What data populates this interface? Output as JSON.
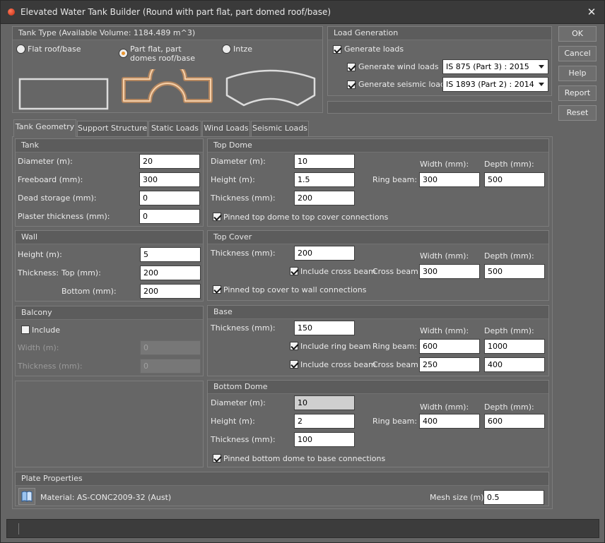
{
  "window": {
    "title": "Elevated Water Tank Builder (Round with part flat, part domed roof/base)",
    "close": "✕"
  },
  "tank_type": {
    "title": "Tank Type (Available Volume: 1184.489 m^3)",
    "options": [
      {
        "label": "Flat roof/base"
      },
      {
        "label1": "Part flat, part",
        "label2": "domes roof/base"
      },
      {
        "label": "Intze"
      }
    ],
    "selected": "Part flat, part domes roof/base"
  },
  "load_generation": {
    "title": "Load Generation",
    "generate_loads": "Generate loads",
    "wind_label": "Generate wind loads",
    "wind_code": "IS 875 (Part 3) : 2015",
    "seismic_label": "Generate seismic loads",
    "seismic_code": "IS 1893 (Part 2) : 2014"
  },
  "buttons": {
    "ok": "OK",
    "cancel": "Cancel",
    "help": "Help",
    "report": "Report",
    "reset": "Reset"
  },
  "tabs": [
    "Tank Geometry",
    "Support Structure",
    "Static Loads",
    "Wind Loads",
    "Seismic Loads"
  ],
  "tank": {
    "title": "Tank",
    "diameter_label": "Diameter (m):",
    "diameter": "20",
    "freeboard_label": "Freeboard (mm):",
    "freeboard": "300",
    "dead_label": "Dead storage (mm):",
    "dead": "0",
    "plaster_label": "Plaster thickness (mm):",
    "plaster": "0"
  },
  "wall": {
    "title": "Wall",
    "height_label": "Height (m):",
    "height": "5",
    "thickness_label": "Thickness:",
    "top_label": "Top (mm):",
    "top": "200",
    "bottom_label": "Bottom (mm):",
    "bottom": "200"
  },
  "balcony": {
    "title": "Balcony",
    "include": "Include",
    "width_label": "Width (m):",
    "width": "0",
    "thickness_label": "Thickness (mm):",
    "thickness": "0"
  },
  "top_dome": {
    "title": "Top Dome",
    "diameter_label": "Diameter (m):",
    "diameter": "10",
    "height_label": "Height (m):",
    "height": "1.5",
    "thickness_label": "Thickness (mm):",
    "thickness": "200",
    "width_hdr": "Width (mm):",
    "depth_hdr": "Depth (mm):",
    "ring_label": "Ring beam:",
    "ring_width": "300",
    "ring_depth": "500",
    "pinned": "Pinned top dome to top cover connections"
  },
  "top_cover": {
    "title": "Top Cover",
    "thickness_label": "Thickness (mm):",
    "thickness": "200",
    "width_hdr": "Width (mm):",
    "depth_hdr": "Depth (mm):",
    "include_cross": "Include cross beam",
    "cross_label": "Cross beam:",
    "cross_width": "300",
    "cross_depth": "500",
    "pinned": "Pinned top cover to wall connections"
  },
  "base": {
    "title": "Base",
    "thickness_label": "Thickness (mm):",
    "thickness": "150",
    "width_hdr": "Width (mm):",
    "depth_hdr": "Depth (mm):",
    "include_ring": "Include ring beam",
    "ring_label": "Ring beam:",
    "ring_width": "600",
    "ring_depth": "1000",
    "include_cross": "Include cross beam",
    "cross_label": "Cross beam:",
    "cross_width": "250",
    "cross_depth": "400"
  },
  "bottom_dome": {
    "title": "Bottom Dome",
    "diameter_label": "Diameter (m):",
    "diameter": "10",
    "height_label": "Height (m):",
    "height": "2",
    "thickness_label": "Thickness (mm):",
    "thickness": "100",
    "width_hdr": "Width (mm):",
    "depth_hdr": "Depth (mm):",
    "ring_label": "Ring beam:",
    "ring_width": "400",
    "ring_depth": "600",
    "pinned": "Pinned bottom dome to base connections"
  },
  "plate": {
    "title": "Plate Properties",
    "material": "Material: AS-CONC2009-32 (Aust)",
    "mesh_label": "Mesh size (m):",
    "mesh": "0.5"
  },
  "colors": {
    "accent": "#e8942e",
    "background": "#656565",
    "panel": "#5c5c5c"
  }
}
